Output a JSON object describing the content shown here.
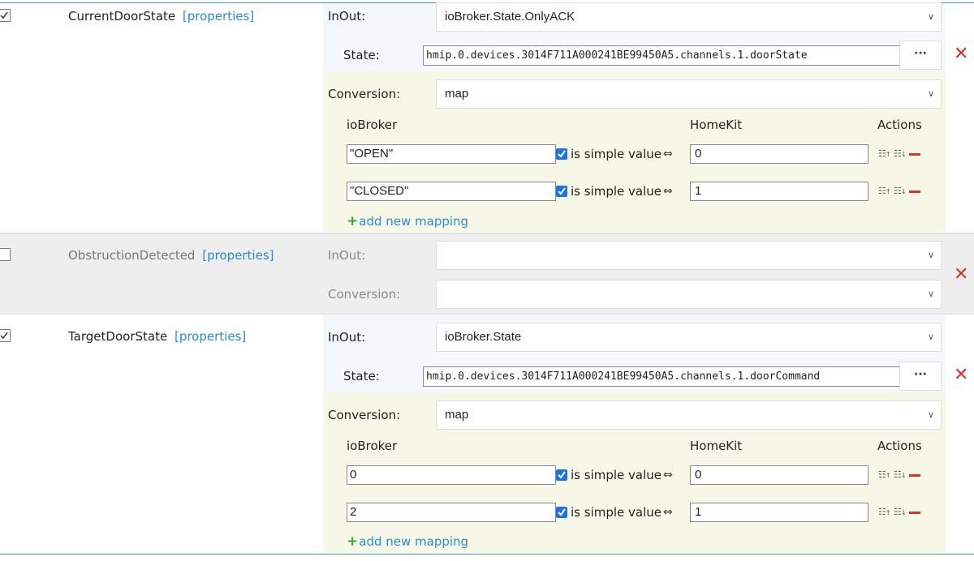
{
  "properties_label": "[properties]",
  "rows": [
    {
      "name": "CurrentDoorState",
      "checked": true,
      "inout_label": "InOut:",
      "inout_value": "ioBroker.State.OnlyACK",
      "state_label": "State:",
      "state_value": "hmip.0.devices.3014F711A000241BE99450A5.channels.1.doorState",
      "conversion_label": "Conversion:",
      "conversion_value": "map",
      "mappings": [
        {
          "iobroker": "\"OPEN\"",
          "simple": true,
          "homekit": "0"
        },
        {
          "iobroker": "\"CLOSED\"",
          "simple": true,
          "homekit": "1"
        }
      ]
    },
    {
      "name": "ObstructionDetected",
      "checked": false,
      "inout_label": "InOut:",
      "inout_value": "",
      "conversion_label": "Conversion:",
      "conversion_value": ""
    },
    {
      "name": "TargetDoorState",
      "checked": true,
      "inout_label": "InOut:",
      "inout_value": "ioBroker.State",
      "state_label": "State:",
      "state_value": "hmip.0.devices.3014F711A000241BE99450A5.channels.1.doorCommand",
      "conversion_label": "Conversion:",
      "conversion_value": "map",
      "mappings": [
        {
          "iobroker": "0",
          "simple": true,
          "homekit": "0"
        },
        {
          "iobroker": "2",
          "simple": true,
          "homekit": "1"
        }
      ]
    }
  ],
  "mapping_headers": {
    "iobroker": "ioBroker",
    "homekit": "HomeKit",
    "actions": "Actions"
  },
  "simple_value_label": "is simple value",
  "arrow_symbol": "⇔",
  "add_mapping_label": "add new mapping",
  "dots_label": "···",
  "delete_symbol": "✕",
  "colors": {
    "link": "#2a8bd1",
    "delete": "#d9342b",
    "checkbox": "#1a73e8",
    "add": "#3aa23a"
  }
}
